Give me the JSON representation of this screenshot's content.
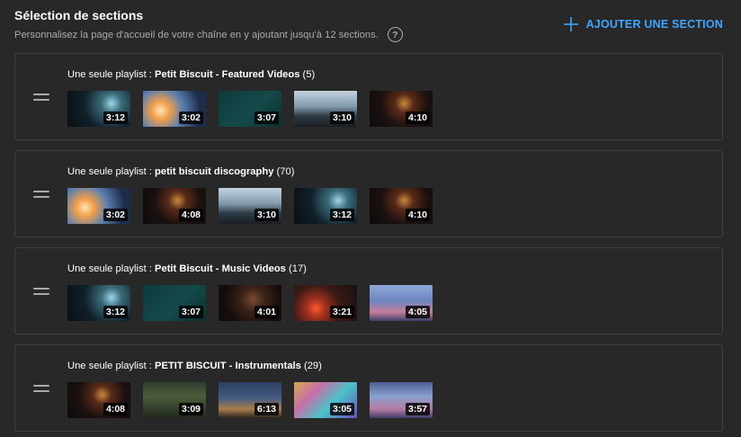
{
  "header": {
    "title": "Sélection de sections",
    "subtitle": "Personnalisez la page d'accueil de votre chaîne en y ajoutant jusqu'à 12 sections.",
    "help_icon_glyph": "?",
    "add_section_label": "AJOUTER UNE SECTION"
  },
  "colors": {
    "background": "#282828",
    "accent": "#3ea6ff",
    "border": "#3f3f3f",
    "secondary_text": "#aaaaaa"
  },
  "sections": [
    {
      "prefix": "Une seule playlist : ",
      "name": "Petit Biscuit - Featured Videos",
      "count": " (5)",
      "videos": [
        {
          "duration": "3:12",
          "style": "t-dark-teal"
        },
        {
          "duration": "3:02",
          "style": "t-glow-orange"
        },
        {
          "duration": "3:07",
          "style": "t-teal-card"
        },
        {
          "duration": "3:10",
          "style": "t-lake"
        },
        {
          "duration": "4:10",
          "style": "t-red-dark"
        }
      ]
    },
    {
      "prefix": "Une seule playlist : ",
      "name": "petit biscuit discography",
      "count": " (70)",
      "videos": [
        {
          "duration": "3:02",
          "style": "t-glow-orange"
        },
        {
          "duration": "4:08",
          "style": "t-red-dark"
        },
        {
          "duration": "3:10",
          "style": "t-lake"
        },
        {
          "duration": "3:12",
          "style": "t-dark-teal"
        },
        {
          "duration": "4:10",
          "style": "t-red-dark"
        }
      ]
    },
    {
      "prefix": "Une seule playlist : ",
      "name": "Petit Biscuit - Music Videos",
      "count": " (17)",
      "videos": [
        {
          "duration": "3:12",
          "style": "t-dark-teal"
        },
        {
          "duration": "3:07",
          "style": "t-teal-card"
        },
        {
          "duration": "4:01",
          "style": "t-face-dark"
        },
        {
          "duration": "3:21",
          "style": "t-red-fire"
        },
        {
          "duration": "4:05",
          "style": "t-blue-haze"
        }
      ]
    },
    {
      "prefix": "Une seule playlist : ",
      "name": "PETIT BISCUIT - Instrumentals",
      "count": " (29)",
      "videos": [
        {
          "duration": "4:08",
          "style": "t-red-dark"
        },
        {
          "duration": "3:09",
          "style": "t-forest"
        },
        {
          "duration": "6:13",
          "style": "t-night-city"
        },
        {
          "duration": "3:05",
          "style": "t-rainbow"
        },
        {
          "duration": "3:57",
          "style": "t-cage"
        }
      ]
    }
  ]
}
